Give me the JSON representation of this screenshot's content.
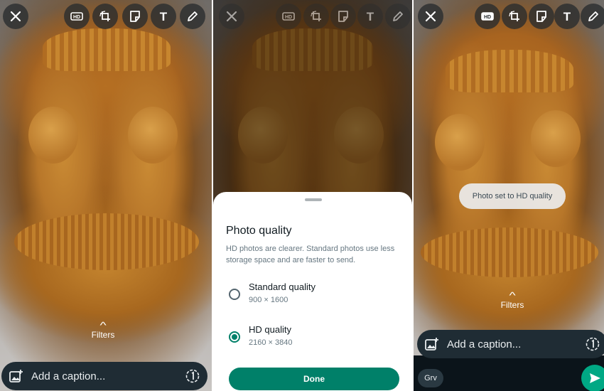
{
  "panel_left": {
    "filters_label": "Filters",
    "caption_placeholder": "Add a caption...",
    "toolbar": {
      "hd_label": "HD",
      "text_label": "T"
    }
  },
  "panel_middle": {
    "toolbar": {
      "hd_label": "HD",
      "text_label": "T"
    },
    "sheet": {
      "title": "Photo quality",
      "description": "HD photos are clearer. Standard photos use less storage space and are faster to send.",
      "options": [
        {
          "label": "Standard quality",
          "resolution": "900 × 1600",
          "selected": false
        },
        {
          "label": "HD quality",
          "resolution": "2160 × 3840",
          "selected": true
        }
      ],
      "done_label": "Done"
    }
  },
  "panel_right": {
    "toolbar": {
      "hd_label": "HD",
      "text_label": "T"
    },
    "toast": "Photo set to HD quality",
    "filters_label": "Filters",
    "caption_placeholder": "Add a caption...",
    "recipient_chip": "Grv"
  },
  "colors": {
    "accent_green": "#008069",
    "send_green": "#00a884",
    "caption_bg": "#1f2c34",
    "toolbar_bg": "#282c2e"
  },
  "icons": [
    "close-icon",
    "hd-icon",
    "crop-rotate-icon",
    "sticker-icon",
    "text-icon",
    "pencil-icon",
    "add-image-icon",
    "view-once-icon",
    "chevron-up-icon",
    "send-icon"
  ]
}
